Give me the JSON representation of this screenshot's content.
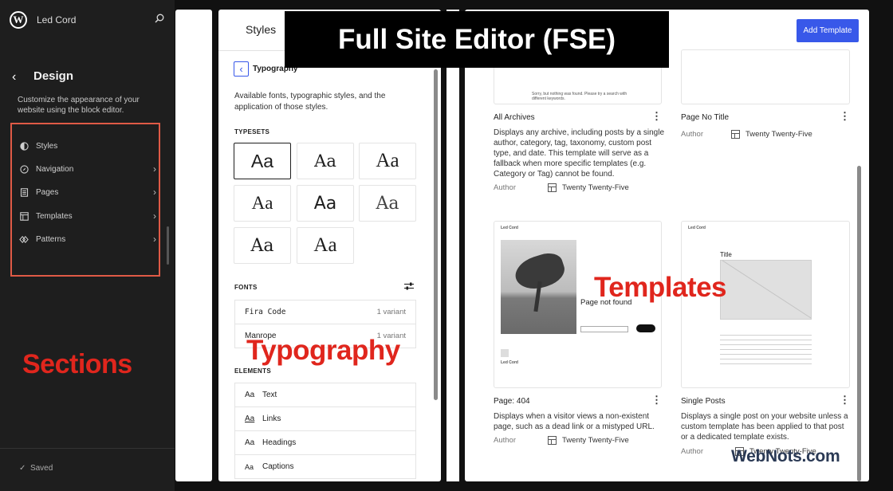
{
  "sidebar": {
    "site_title": "Led Cord",
    "heading": "Design",
    "description": "Customize the appearance of your website using the block editor.",
    "items": [
      {
        "label": "Styles",
        "icon": "half-circle-icon"
      },
      {
        "label": "Navigation",
        "icon": "compass-icon"
      },
      {
        "label": "Pages",
        "icon": "page-icon"
      },
      {
        "label": "Templates",
        "icon": "layout-icon"
      },
      {
        "label": "Patterns",
        "icon": "diamond-icon"
      }
    ],
    "saved_label": "Saved",
    "annotation": "Sections"
  },
  "styles_panel": {
    "title": "Styles",
    "section_title": "Typography",
    "description": "Available fonts, typographic styles, and the application of those styles.",
    "typesets_label": "TYPESETS",
    "typesets": [
      "Aa",
      "Aa",
      "Aa",
      "Aa",
      "Aa",
      "Aa",
      "Aa",
      "Aa"
    ],
    "fonts_label": "FONTS",
    "fonts": [
      {
        "name": "Fira Code",
        "variants": "1 variant"
      },
      {
        "name": "Manrope",
        "variants": "1 variant"
      }
    ],
    "elements_label": "ELEMENTS",
    "elements": [
      {
        "sample": "Aa",
        "label": "Text"
      },
      {
        "sample": "Aa",
        "label": "Links"
      },
      {
        "sample": "Aa",
        "label": "Headings"
      },
      {
        "sample": "Aa",
        "label": "Captions"
      }
    ],
    "annotation": "Typography"
  },
  "banner": "Full Site Editor (FSE)",
  "templates_panel": {
    "add_button": "Add Template",
    "annotation": "Templates",
    "cards": [
      {
        "name": "All Archives",
        "description": "Displays any archive, including posts by a single author, category, tag, taxonomy, custom post type, and date. This template will serve as a fallback when more specific templates (e.g. Category or Tag) cannot be found.",
        "author_label": "Author",
        "theme": "Twenty Twenty-Five",
        "preview_text": "Sorry, but nothing was found. Please try a search with different keywords."
      },
      {
        "name": "Page No Title",
        "description": "",
        "author_label": "Author",
        "theme": "Twenty Twenty-Five",
        "preview_text": ""
      },
      {
        "name": "Page: 404",
        "description": "Displays when a visitor views a non-existent page, such as a dead link or a mistyped URL.",
        "author_label": "Author",
        "theme": "Twenty Twenty-Five",
        "preview_site": "Led Cord",
        "preview_heading": "Page not found"
      },
      {
        "name": "Single Posts",
        "description": "Displays a single post on your website unless a custom template has been applied to that post or a dedicated template exists.",
        "author_label": "Author",
        "theme": "Twenty Twenty-Five",
        "preview_site": "Led Cord",
        "preview_heading": "Title"
      }
    ]
  },
  "watermark": "WebNots.com",
  "colors": {
    "accent": "#3858e9",
    "annotation_red": "#e0261d",
    "sidebar_bg": "#1e1e1e",
    "highlight_box": "#e05a46"
  }
}
